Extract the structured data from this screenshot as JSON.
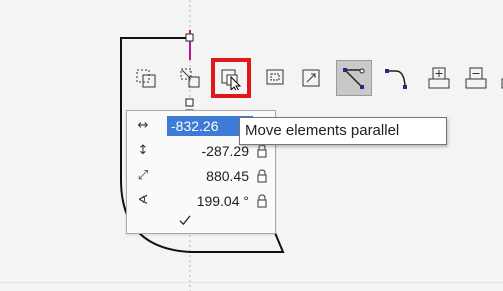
{
  "tooltip": {
    "text": "Move elements parallel"
  },
  "toolbar": {
    "buttons": [
      {
        "name": "select-frame-icon",
        "state": "normal"
      },
      {
        "name": "rotate-elements-icon",
        "state": "normal"
      },
      {
        "name": "move-elements-parallel-icon",
        "state": "highlighted"
      },
      {
        "name": "offset-copy-icon",
        "state": "normal"
      },
      {
        "name": "scale-elements-icon",
        "state": "normal"
      },
      {
        "name": "line-corner-icon",
        "state": "active"
      },
      {
        "name": "arc-corner-icon",
        "state": "normal"
      },
      {
        "name": "add-element-plus-icon",
        "state": "normal"
      },
      {
        "name": "stack-element-icon",
        "state": "normal"
      },
      {
        "name": "remove-element-minus-icon",
        "state": "normal"
      }
    ]
  },
  "numeric_input": {
    "rows": [
      {
        "icon": "horizontal-arrows-icon",
        "value": "-832.26",
        "selected": true,
        "locked": false
      },
      {
        "icon": "vertical-arrows-icon",
        "value": "-287.29",
        "selected": false,
        "locked": true
      },
      {
        "icon": "diagonal-length-icon",
        "value": "880.45",
        "selected": false,
        "locked": true
      },
      {
        "icon": "angle-icon",
        "value": "199.04 °",
        "selected": false,
        "locked": true
      }
    ]
  },
  "colors": {
    "highlight_border": "#e0171b",
    "selection": "#3d7bd6",
    "guide_line": "#b8188f"
  }
}
